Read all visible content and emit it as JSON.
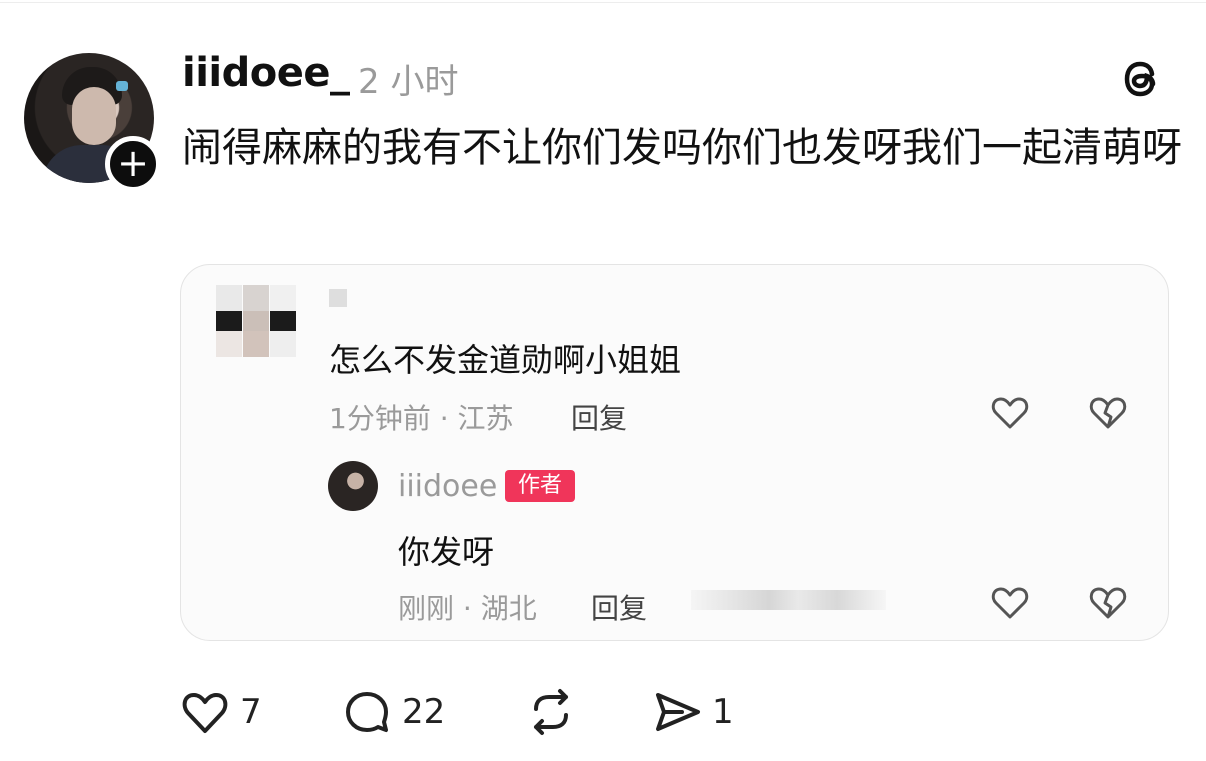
{
  "post": {
    "username": "iiidoee_",
    "time": "2 小时",
    "text": "闹得麻麻的我有不让你们发吗你们也发呀我们一起清萌呀"
  },
  "embed": {
    "comment": {
      "text": "怎么不发金道勋啊小姐姐",
      "meta": "1分钟前 · 江苏",
      "reply_label": "回复"
    },
    "reply": {
      "username": "iiidoee",
      "badge": "作者",
      "text": "你发呀",
      "meta": "刚刚 · 湖北",
      "reply_label": "回复"
    }
  },
  "actions": {
    "likes": "7",
    "comments": "22",
    "shares": "1"
  },
  "icons": [
    "plus-icon",
    "threads-logo-icon",
    "heart-icon",
    "broken-heart-icon",
    "comment-icon",
    "repost-icon",
    "share-icon"
  ]
}
